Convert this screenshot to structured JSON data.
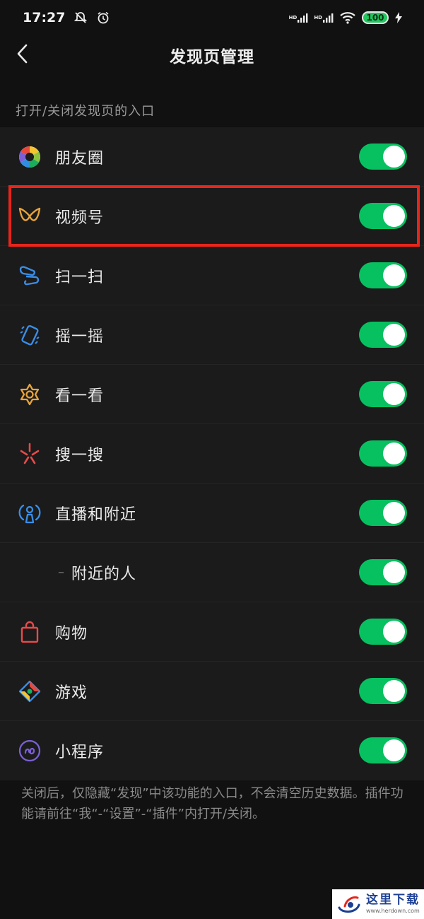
{
  "status_bar": {
    "time": "17:27",
    "signal_labels": [
      "HD",
      "HD"
    ],
    "battery": "100",
    "icons": [
      "mute-bell-icon",
      "alarm-icon",
      "signal-icon",
      "wifi-icon",
      "charging-icon"
    ]
  },
  "header": {
    "title": "发现页管理",
    "back_icon": "chevron-left-icon"
  },
  "section": {
    "label": "打开/关闭发现页的入口"
  },
  "items": [
    {
      "label": "朋友圈",
      "icon": "moments-icon",
      "enabled": true
    },
    {
      "label": "视频号",
      "icon": "channels-icon",
      "enabled": true
    },
    {
      "label": "扫一扫",
      "icon": "scan-icon",
      "enabled": true
    },
    {
      "label": "摇一摇",
      "icon": "shake-icon",
      "enabled": true
    },
    {
      "label": "看一看",
      "icon": "top-stories-icon",
      "enabled": true
    },
    {
      "label": "搜一搜",
      "icon": "search-icon",
      "enabled": true
    },
    {
      "label": "直播和附近",
      "icon": "live-nearby-icon",
      "enabled": true
    },
    {
      "label": "附近的人",
      "icon": "",
      "enabled": true,
      "sub": true
    },
    {
      "label": "购物",
      "icon": "shopping-bag-icon",
      "enabled": true
    },
    {
      "label": "游戏",
      "icon": "games-icon",
      "enabled": true
    },
    {
      "label": "小程序",
      "icon": "mini-programs-icon",
      "enabled": true
    }
  ],
  "footer": {
    "note": "关闭后，仅隐藏“发现”中该功能的入口，不会清空历史数据。插件功能请前往“我“-“设置”-“插件”内打开/关闭。"
  },
  "watermark": {
    "text": "这里下载",
    "url": "www.herdown.com"
  },
  "colors": {
    "background": "#111111",
    "list_background": "#1b1b1b",
    "toggle_on": "#07c160",
    "highlight": "#e8251a"
  }
}
